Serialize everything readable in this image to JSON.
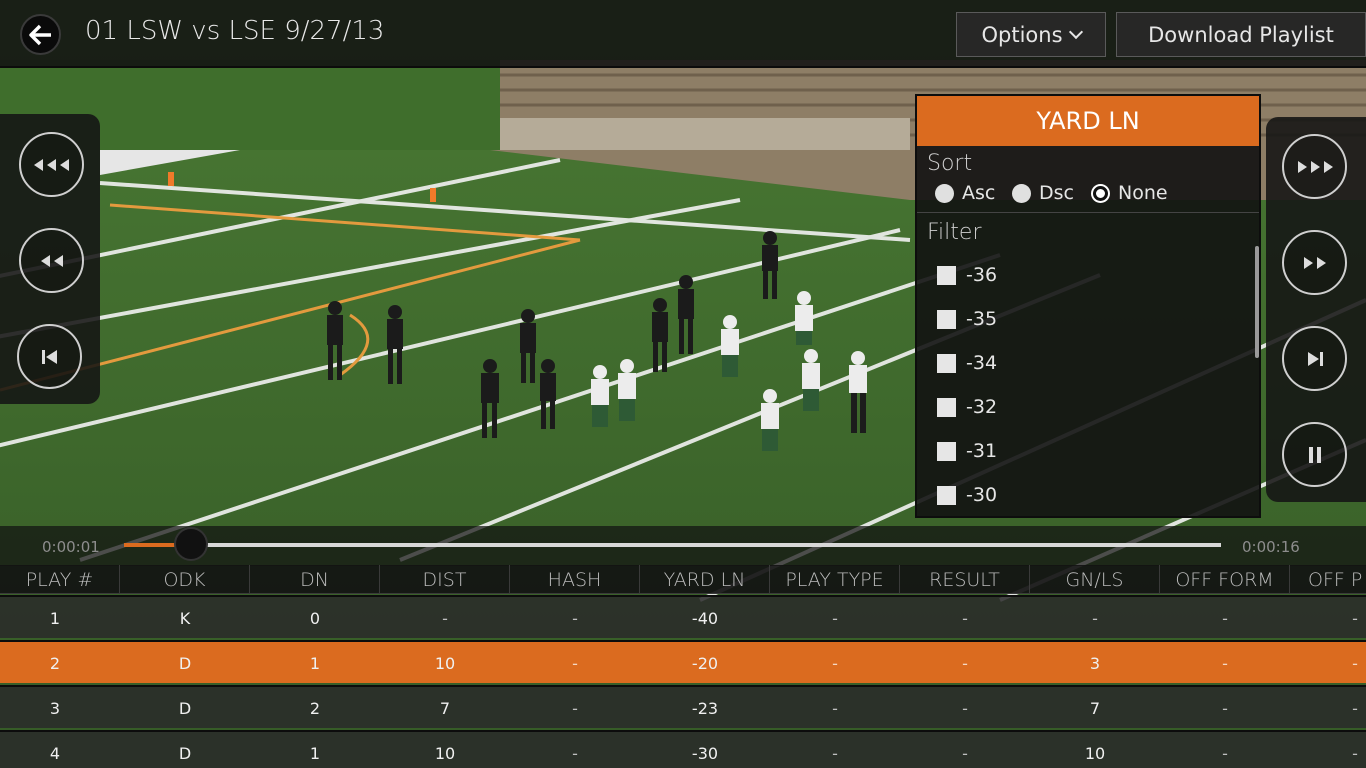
{
  "header": {
    "title": "01 LSW vs LSE 9/27/13",
    "options_label": "Options",
    "download_label": "Download Playlist"
  },
  "icons": {
    "back": "back-arrow-icon",
    "options_chevron": "chevron-down-icon",
    "left_controls": [
      "fast-rewind-icon",
      "rewind-icon",
      "skip-back-icon"
    ],
    "right_controls": [
      "fast-forward-icon",
      "forward-icon",
      "skip-forward-icon",
      "pause-icon"
    ]
  },
  "colors": {
    "accent": "#db6b1f",
    "field": "#3f6a2d",
    "panel": "#141414"
  },
  "filter_popup": {
    "title": "YARD LN",
    "sort_label": "Sort",
    "sort_options": [
      "Asc",
      "Dsc",
      "None"
    ],
    "sort_selected": "None",
    "filter_label": "Filter",
    "filter_values": [
      "-36",
      "-35",
      "-34",
      "-32",
      "-31",
      "-30"
    ]
  },
  "player": {
    "current_time": "0:00:01",
    "total_time": "0:00:16",
    "progress": 0.061
  },
  "table": {
    "columns": [
      "PLAY #",
      "ODK",
      "DN",
      "DIST",
      "HASH",
      "YARD LN",
      "PLAY TYPE",
      "RESULT",
      "GN/LS",
      "OFF FORM",
      "OFF P"
    ],
    "rows": [
      [
        "1",
        "K",
        "0",
        "-",
        "-",
        "-40",
        "-",
        "-",
        "-",
        "-",
        "-"
      ],
      [
        "2",
        "D",
        "1",
        "10",
        "-",
        "-20",
        "-",
        "-",
        "3",
        "-",
        "-"
      ],
      [
        "3",
        "D",
        "2",
        "7",
        "-",
        "-23",
        "-",
        "-",
        "7",
        "-",
        "-"
      ],
      [
        "4",
        "D",
        "1",
        "10",
        "-",
        "-30",
        "-",
        "-",
        "10",
        "-",
        "-"
      ]
    ],
    "selected_row": 1
  }
}
